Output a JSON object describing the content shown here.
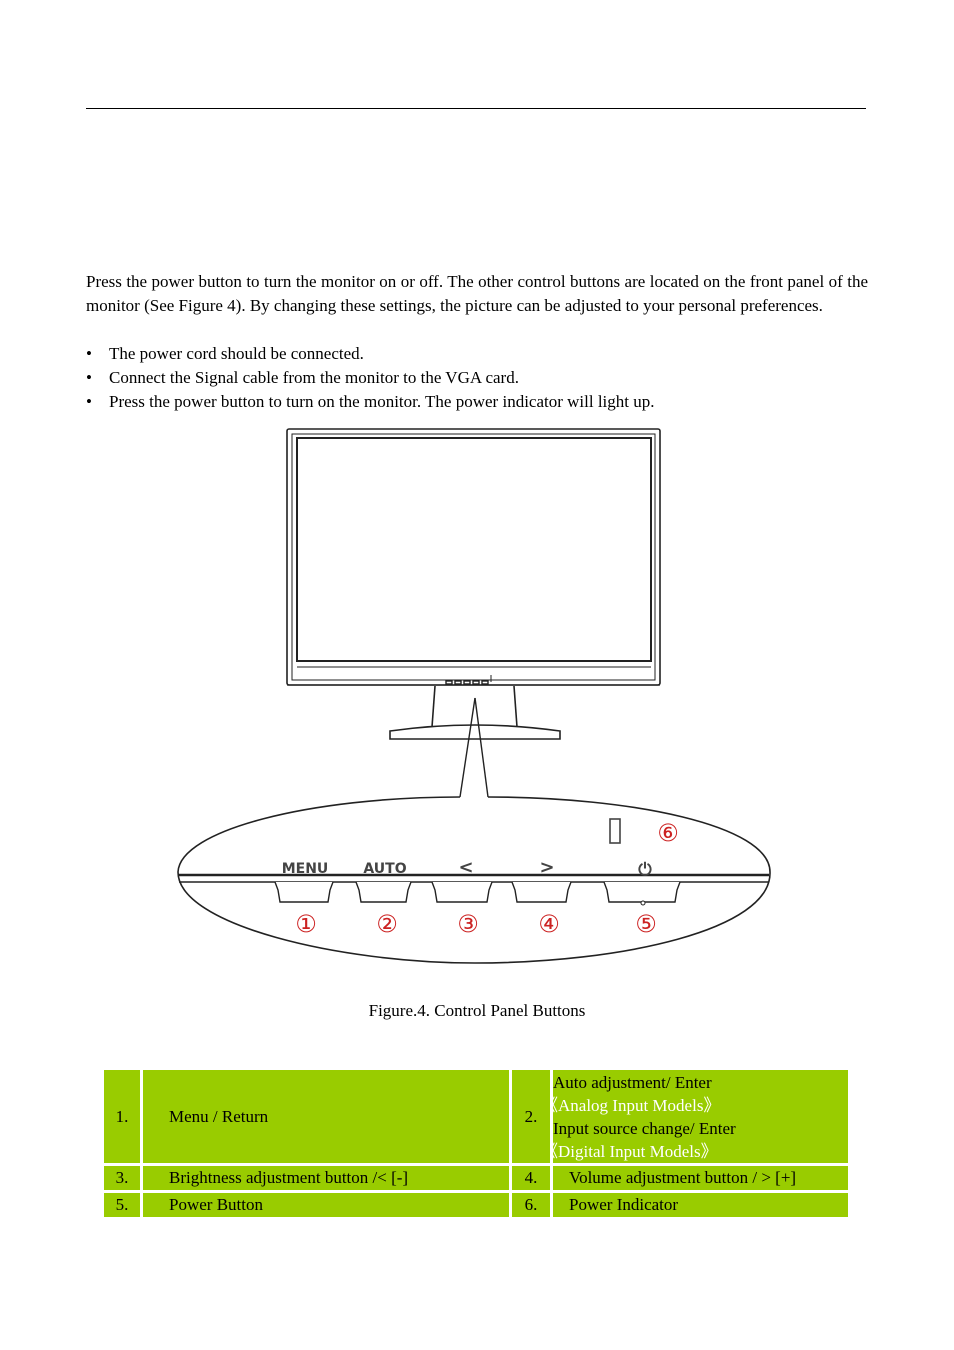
{
  "intro": {
    "paragraph": "Press the power button to turn the monitor on or off. The other control buttons are located on the front panel of the monitor (See Figure 4). By changing these settings, the picture can be adjusted to your personal preferences.",
    "bullet_glyph": "•",
    "bullets": [
      "The power cord should be connected.",
      "Connect the Signal cable from the monitor to the VGA card.",
      "Press the power button to turn on the monitor. The power indicator will light up."
    ]
  },
  "figure": {
    "button_labels": [
      "MENU",
      "AUTO",
      "<",
      ">"
    ],
    "power_symbol": "⏻",
    "callouts": [
      "①",
      "②",
      "③",
      "④",
      "⑤",
      "⑥"
    ],
    "callout_color": "#cc2222",
    "caption": "Figure.4. Control Panel Buttons"
  },
  "legend_table": {
    "background": "#99cc00",
    "rows": [
      {
        "left_num": "1.",
        "left_desc": "Menu / Return",
        "right_num": "2.",
        "right_lines": [
          {
            "text": "Auto adjustment/ Enter",
            "tone": "dark"
          },
          {
            "text": "《Analog Input Models》",
            "tone": "light"
          },
          {
            "text": "Input source change/ Enter",
            "tone": "dark"
          },
          {
            "text": "《Digital Input Models》",
            "tone": "light"
          }
        ]
      },
      {
        "left_num": "3.",
        "left_desc": "Brightness adjustment button /< [-]",
        "right_num": "4.",
        "right_desc": "Volume adjustment button / > [+]"
      },
      {
        "left_num": "5.",
        "left_desc": "Power Button",
        "right_num": "6.",
        "right_desc": "Power Indicator"
      }
    ]
  }
}
